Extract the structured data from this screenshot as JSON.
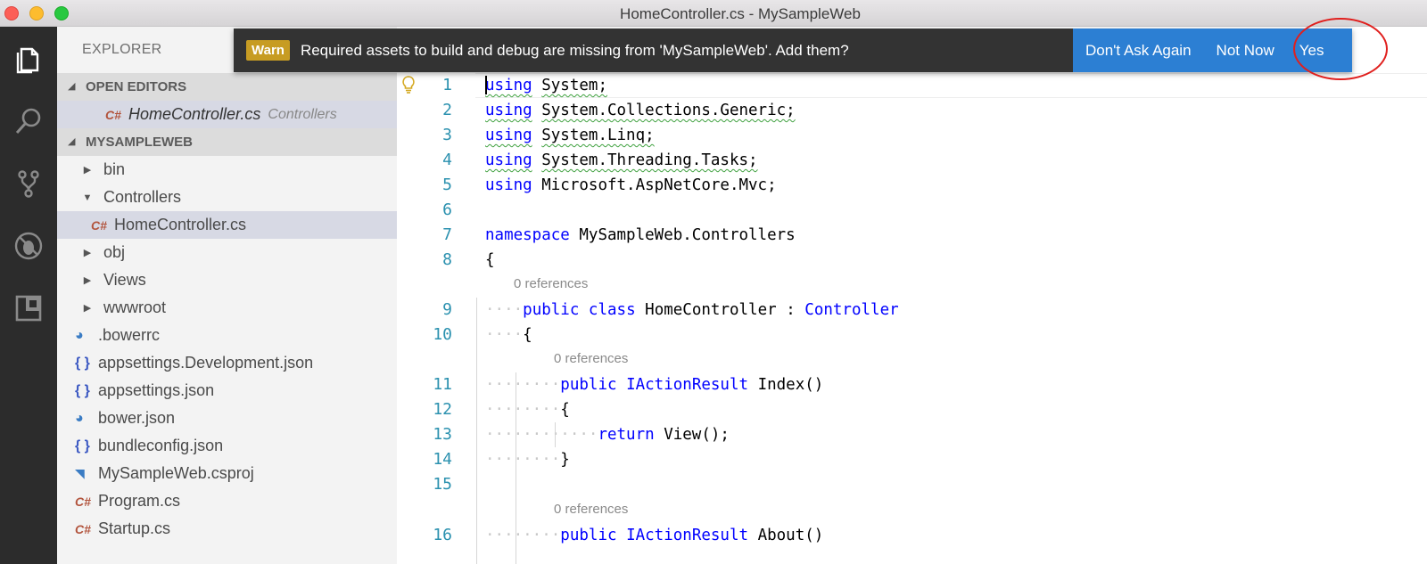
{
  "window": {
    "title": "HomeController.cs - MySampleWeb"
  },
  "activity_bar": {
    "icons": [
      "files-icon",
      "search-icon",
      "source-control-icon",
      "debug-icon",
      "extensions-icon"
    ]
  },
  "sidebar": {
    "header": "EXPLORER",
    "open_editors": {
      "title": "OPEN EDITORS",
      "items": [
        {
          "icon": "C#",
          "name": "HomeController.cs",
          "dir": "Controllers"
        }
      ]
    },
    "project": {
      "title": "MYSAMPLEWEB",
      "items": [
        {
          "label": "bin",
          "twisty": "▶",
          "icon": ""
        },
        {
          "label": "Controllers",
          "twisty": "▼",
          "icon": ""
        },
        {
          "label": "HomeController.cs",
          "twisty": "",
          "icon": "C#"
        },
        {
          "label": "obj",
          "twisty": "▶",
          "icon": ""
        },
        {
          "label": "Views",
          "twisty": "▶",
          "icon": ""
        },
        {
          "label": "wwwroot",
          "twisty": "▶",
          "icon": ""
        },
        {
          "label": ".bowerrc",
          "twisty": "",
          "icon": "bower"
        },
        {
          "label": "appsettings.Development.json",
          "twisty": "",
          "icon": "{ }"
        },
        {
          "label": "appsettings.json",
          "twisty": "",
          "icon": "{ }"
        },
        {
          "label": "bower.json",
          "twisty": "",
          "icon": "bower"
        },
        {
          "label": "bundleconfig.json",
          "twisty": "",
          "icon": "{ }"
        },
        {
          "label": "MySampleWeb.csproj",
          "twisty": "",
          "icon": "rss"
        },
        {
          "label": "Program.cs",
          "twisty": "",
          "icon": "C#"
        },
        {
          "label": "Startup.cs",
          "twisty": "",
          "icon": "C#"
        }
      ]
    }
  },
  "notification": {
    "badge": "Warn",
    "message": "Required assets to build and debug are missing from 'MySampleWeb'. Add them?",
    "buttons": {
      "dont_ask": "Don't Ask Again",
      "not_now": "Not Now",
      "yes": "Yes"
    }
  },
  "editor": {
    "codelens": [
      "0 references",
      "0 references",
      "0 references"
    ],
    "lines": [
      {
        "num": "1",
        "parts": [
          [
            "kw",
            "using"
          ],
          [
            "",
            "System;"
          ]
        ]
      },
      {
        "num": "2",
        "parts": [
          [
            "kw",
            "using"
          ],
          [
            "",
            "System.Collections.Generic;"
          ]
        ]
      },
      {
        "num": "3",
        "parts": [
          [
            "kw",
            "using"
          ],
          [
            "",
            "System.Linq;"
          ]
        ]
      },
      {
        "num": "4",
        "parts": [
          [
            "kw",
            "using"
          ],
          [
            "",
            "System.Threading.Tasks;"
          ]
        ]
      },
      {
        "num": "5",
        "parts": [
          [
            "kw",
            "using"
          ],
          [
            "",
            "Microsoft.AspNetCore.Mvc;"
          ]
        ]
      },
      {
        "num": "6",
        "parts": []
      },
      {
        "num": "7",
        "parts": [
          [
            "kw",
            "namespace"
          ],
          [
            "",
            "MySampleWeb.Controllers"
          ]
        ]
      },
      {
        "num": "8",
        "parts": [
          [
            "",
            "{"
          ]
        ]
      },
      {
        "num": "9",
        "parts": [
          [
            "kw",
            "public"
          ],
          [
            "kw",
            "class"
          ],
          [
            "",
            "HomeController :"
          ],
          [
            "typ",
            "Controller"
          ]
        ]
      },
      {
        "num": "10",
        "parts": [
          [
            "",
            "{"
          ]
        ]
      },
      {
        "num": "11",
        "parts": [
          [
            "kw",
            "public"
          ],
          [
            "typ",
            "IActionResult"
          ],
          [
            "",
            "Index()"
          ]
        ]
      },
      {
        "num": "12",
        "parts": [
          [
            "",
            "{"
          ]
        ]
      },
      {
        "num": "13",
        "parts": [
          [
            "kw",
            "return"
          ],
          [
            "",
            "View();"
          ]
        ]
      },
      {
        "num": "14",
        "parts": [
          [
            "",
            "}"
          ]
        ]
      },
      {
        "num": "15",
        "parts": []
      },
      {
        "num": "16",
        "parts": [
          [
            "kw",
            "public"
          ],
          [
            "typ",
            "IActionResult"
          ],
          [
            "",
            "About()"
          ]
        ]
      }
    ]
  }
}
